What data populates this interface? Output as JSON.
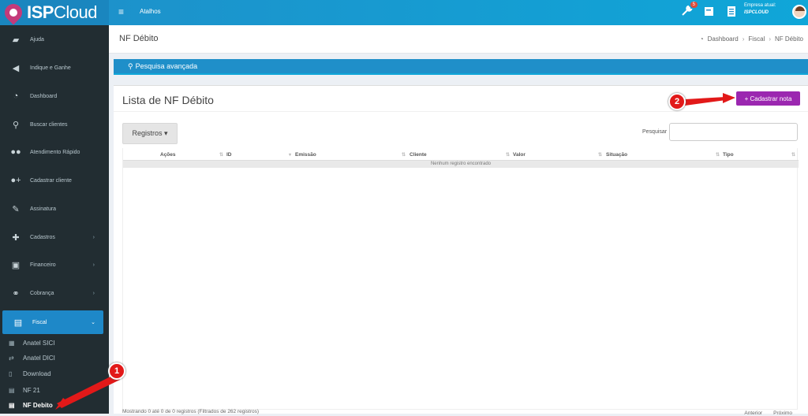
{
  "topbar": {
    "brand_bold": "ISP",
    "brand_light": "Cloud",
    "atalhos": "Atalhos",
    "badge_count": "5",
    "empresa_label": "Empresa atual:",
    "empresa_name": "ISPCLOUD"
  },
  "sidebar": {
    "items": [
      {
        "label": "Ajuda",
        "icon": "book-icon"
      },
      {
        "label": "Indique e Ganhe",
        "icon": "megaphone-icon"
      },
      {
        "label": "Dashboard",
        "icon": "dashboard-icon"
      },
      {
        "label": "Buscar clientes",
        "icon": "search-icon"
      },
      {
        "label": "Atendimento Rápido",
        "icon": "users-icon"
      },
      {
        "label": "Cadastrar cliente",
        "icon": "user-plus-icon"
      },
      {
        "label": "Assinatura",
        "icon": "pencil-icon"
      },
      {
        "label": "Cadastros",
        "icon": "plus-icon"
      },
      {
        "label": "Financeiro",
        "icon": "money-icon"
      },
      {
        "label": "Cobrança",
        "icon": "handshake-icon"
      },
      {
        "label": "Fiscal",
        "icon": "file-icon"
      }
    ],
    "subitems": [
      {
        "label": "Anatel SICI",
        "icon": "table-icon"
      },
      {
        "label": "Anatel DICI",
        "icon": "exchange-icon"
      },
      {
        "label": "Download",
        "icon": "file-o-icon"
      },
      {
        "label": "NF 21",
        "icon": "file-text-icon"
      },
      {
        "label": "NF Debito",
        "icon": "file-text-icon"
      }
    ]
  },
  "header": {
    "title": "NF Débito",
    "breadcrumb": [
      "Dashboard",
      "Fiscal",
      "NF Débito"
    ]
  },
  "search_bar": {
    "label": "Pesquisa avançada"
  },
  "box": {
    "title": "Lista de NF Débito",
    "add_button": "+ Cadastrar nota",
    "records_button": "Registros ▾",
    "search_label": "Pesquisar",
    "search_value": "",
    "columns": [
      "Ações",
      "ID",
      "Emissão",
      "Cliente",
      "Valor",
      "Situação",
      "Tipo"
    ],
    "empty_message": "Nenhum registro encontrado",
    "info": "Mostrando 0 até 0 de 0 registros (Filtrados de 262 registros)",
    "prev": "Anterior",
    "next": "Próximo"
  },
  "markers": [
    "1",
    "2"
  ],
  "colors": {
    "accent": "#1f8fc9",
    "sidebar": "#222d32",
    "purple_button": "#9b27b0",
    "marker": "#e21919"
  }
}
